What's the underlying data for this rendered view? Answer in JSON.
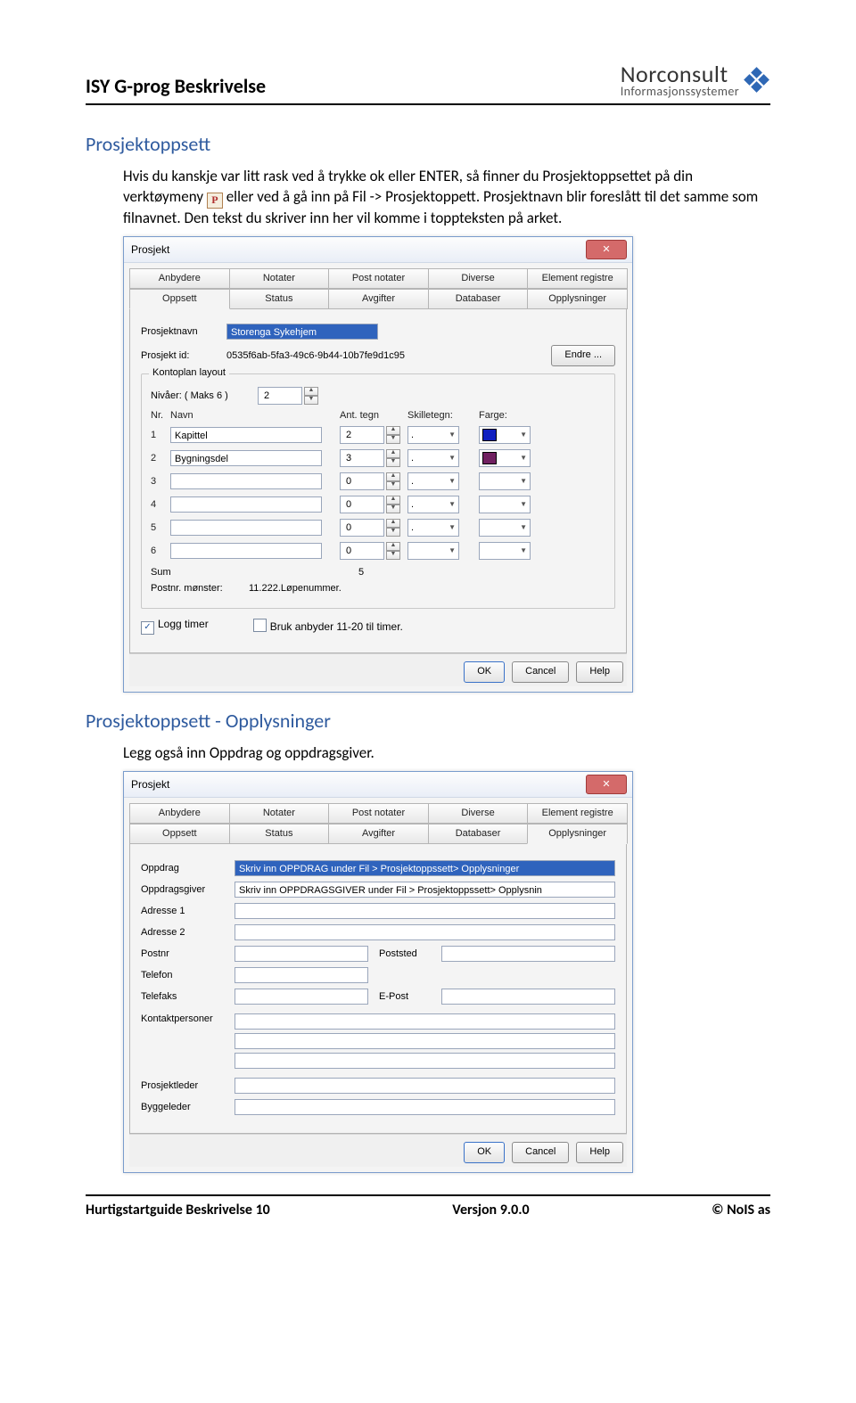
{
  "header": {
    "title": "ISY G-prog Beskrivelse",
    "brand_top": "Norconsult",
    "brand_bottom": "Informasjonssystemer"
  },
  "section1": {
    "heading": "Prosjektoppsett",
    "para": "Hvis du kanskje var litt rask ved å trykke ok eller ENTER, så finner du Prosjektoppsettet på din verktøymeny eller ved å gå inn på Fil -> Prosjektoppett. Prosjektnavn blir foreslått til det samme som filnavnet. Den tekst du skriver inn her vil komme i toppteksten på arket.",
    "inline_icon": "P"
  },
  "dialog1": {
    "title": "Prosjekt",
    "tabs_row1": [
      "Anbydere",
      "Notater",
      "Post notater",
      "Diverse",
      "Element registre"
    ],
    "tabs_row2": [
      "Oppsett",
      "Status",
      "Avgifter",
      "Databaser",
      "Opplysninger"
    ],
    "field_prosjektnavn_label": "Prosjektnavn",
    "field_prosjektnavn_value": "Storenga Sykehjem",
    "field_prosjektid_label": "Prosjekt id:",
    "field_prosjektid_value": "0535f6ab-5fa3-49c6-9b44-10b7fe9d1c95",
    "btn_endre": "Endre ...",
    "group_title": "Kontoplan layout",
    "nivaer_label": "Nivåer: ( Maks 6 )",
    "nivaer_value": "2",
    "col_nr": "Nr.",
    "col_navn": "Navn",
    "col_ant": "Ant. tegn",
    "col_skille": "Skilletegn:",
    "col_farge": "Farge:",
    "rows": [
      {
        "nr": "1",
        "navn": "Kapittel",
        "ant": "2",
        "sk": ".",
        "farge": "#1020c0"
      },
      {
        "nr": "2",
        "navn": "Bygningsdel",
        "ant": "3",
        "sk": ".",
        "farge": "#702060"
      },
      {
        "nr": "3",
        "navn": "",
        "ant": "0",
        "sk": ".",
        "farge": ""
      },
      {
        "nr": "4",
        "navn": "",
        "ant": "0",
        "sk": ".",
        "farge": ""
      },
      {
        "nr": "5",
        "navn": "",
        "ant": "0",
        "sk": ".",
        "farge": ""
      },
      {
        "nr": "6",
        "navn": "",
        "ant": "0",
        "sk": "",
        "farge": ""
      }
    ],
    "sum_label": "Sum",
    "sum_value": "5",
    "postnr_label": "Postnr. mønster:",
    "postnr_value": "11.222.Løpenummer.",
    "chk_logg": "Logg timer",
    "chk_anbyder": "Bruk anbyder 11-20 til timer.",
    "btn_ok": "OK",
    "btn_cancel": "Cancel",
    "btn_help": "Help"
  },
  "section2": {
    "heading": "Prosjektoppsett - Opplysninger",
    "para": "Legg også inn Oppdrag og oppdragsgiver."
  },
  "dialog2": {
    "title": "Prosjekt",
    "fields": {
      "oppdrag": {
        "label": "Oppdrag",
        "value": "Skriv inn OPPDRAG under Fil > Prosjektoppssett> Opplysninger"
      },
      "oppdragsgiver": {
        "label": "Oppdragsgiver",
        "value": "Skriv inn OPPDRAGSGIVER under Fil > Prosjektoppssett> Opplysnin"
      },
      "adresse1": {
        "label": "Adresse 1"
      },
      "adresse2": {
        "label": "Adresse 2"
      },
      "postnr": {
        "label": "Postnr"
      },
      "poststed": {
        "label": "Poststed"
      },
      "telefon": {
        "label": "Telefon"
      },
      "telefaks": {
        "label": "Telefaks"
      },
      "epost": {
        "label": "E-Post"
      },
      "kontakt": {
        "label": "Kontaktpersoner"
      },
      "prosjektleder": {
        "label": "Prosjektleder"
      },
      "byggeleder": {
        "label": "Byggeleder"
      }
    }
  },
  "footer": {
    "left": "Hurtigstartguide Beskrivelse 10",
    "center": "Versjon 9.0.0",
    "right": "© NoIS as"
  }
}
